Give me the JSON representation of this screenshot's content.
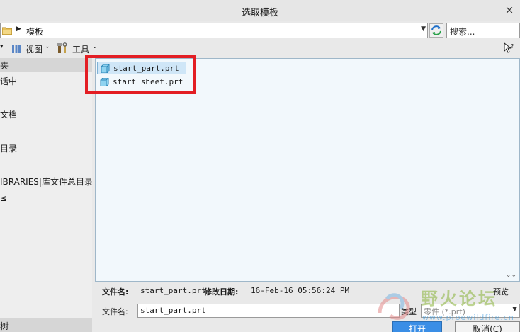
{
  "window": {
    "title": "选取模板",
    "close_glyph": "×"
  },
  "path": {
    "crumb": "模板",
    "search_placeholder": "搜索..."
  },
  "toolbar": {
    "view_label": "视图",
    "tools_label": "工具"
  },
  "sidebar": {
    "header": "夹",
    "items": [
      "话中",
      "文档",
      "目录",
      "IBRARIES|库文件总目录",
      "≤"
    ],
    "footer": "树"
  },
  "files": [
    {
      "name": "start_part.prt",
      "selected": true
    },
    {
      "name": "start_sheet.prt",
      "selected": false
    }
  ],
  "info": {
    "filename_key": "文件名:",
    "filename_val": "start_part.prt",
    "modified_key": "修改日期:",
    "modified_val": "16-Feb-16 05:56:24 PM",
    "preview_label": "预览"
  },
  "form": {
    "filename_label": "文件名:",
    "filename_value": "start_part.prt",
    "type_label": "类型",
    "type_value": "零件 (*.prt)"
  },
  "buttons": {
    "open": "打开",
    "cancel": "取消(C)"
  },
  "watermark": {
    "text": "野火论坛",
    "url": "www.proewildfire.cn"
  },
  "colors": {
    "highlight_box": "#e31e24",
    "selection": "#cfe6f7",
    "open_button": "#3a8ee6"
  }
}
